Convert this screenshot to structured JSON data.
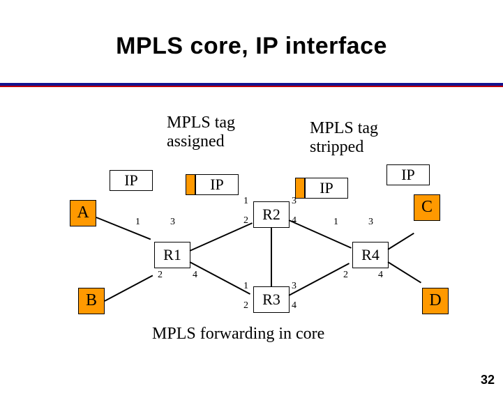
{
  "title": "MPLS core, IP interface",
  "tag_assigned": "MPLS tag\nassigned",
  "tag_stripped": "MPLS tag\nstripped",
  "hosts": {
    "A": "A",
    "B": "B",
    "C": "C",
    "D": "D"
  },
  "routers": {
    "R1": "R1",
    "R2": "R2",
    "R3": "R3",
    "R4": "R4"
  },
  "packets": {
    "ip_left": "IP",
    "ip_mid": "IP",
    "ip_mid2": "IP",
    "ip_right": "IP"
  },
  "ports": {
    "r1_1": "1",
    "r1_3": "3",
    "r1_2": "2",
    "r1_4": "4",
    "r2_1": "1",
    "r2_2": "2",
    "r2_3": "3",
    "r2_4": "4",
    "r3_1": "1",
    "r3_2": "2",
    "r3_3": "3",
    "r3_4": "4",
    "r4_1": "1",
    "r4_3": "3",
    "r4_2": "2",
    "r4_4": "4"
  },
  "caption": "MPLS forwarding in core",
  "page": "32"
}
